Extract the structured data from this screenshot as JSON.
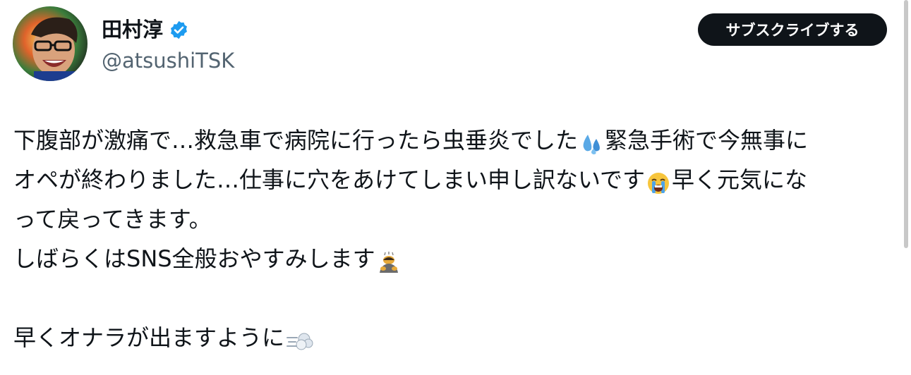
{
  "author": {
    "display_name": "田村淳",
    "handle": "@atsushiTSK",
    "verified": true,
    "verified_color": "#1d9bf0"
  },
  "actions": {
    "subscribe_label": "サブスクライブする"
  },
  "tweet": {
    "line1_a": "下腹部が激痛で…救急車で病院に行ったら虫垂炎でした",
    "emoji1": "sweat-droplets-emoji",
    "line1_b": "緊急手術で今無事に",
    "line2_a": "オペが終わりました…仕事に穴をあけてしまい申し訳ないです",
    "emoji2": "loudly-crying-face-emoji",
    "line2_b": "早く元気にな",
    "line3": "って戻ってきます。",
    "line4_a": "しばらくはSNS全般おやすみします",
    "emoji3": "person-bowing-emoji",
    "line6_a": "早くオナラが出ますように",
    "emoji4": "dashing-away-emoji"
  },
  "colors": {
    "text": "#0f1419",
    "secondary": "#536471",
    "button_bg": "#0f1419"
  }
}
